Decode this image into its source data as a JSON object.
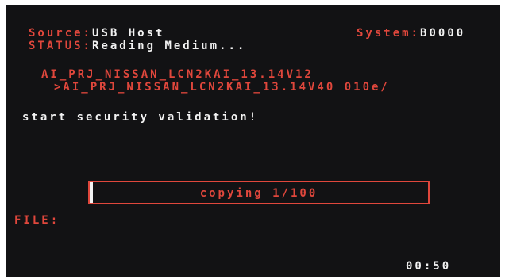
{
  "header": {
    "source_label": "Source:",
    "source_value": "USB Host",
    "system_label": "System:",
    "system_value": "B0000",
    "status_label": "STATUS:",
    "status_value": "Reading Medium..."
  },
  "files": {
    "current_version": "AI_PRJ_NISSAN_LCN2KAI_13.14V12",
    "target_version": ">AI_PRJ_NISSAN_LCN2KAI_13.14V40 010e/"
  },
  "message": "start security validation!",
  "progress": {
    "label": "copying 1/100",
    "current": 1,
    "total": 100
  },
  "file_label": "FILE:",
  "timer": "00:50",
  "colors": {
    "background": "#121214",
    "accent_red": "#e0473c",
    "text_white": "#f2f2f2"
  }
}
